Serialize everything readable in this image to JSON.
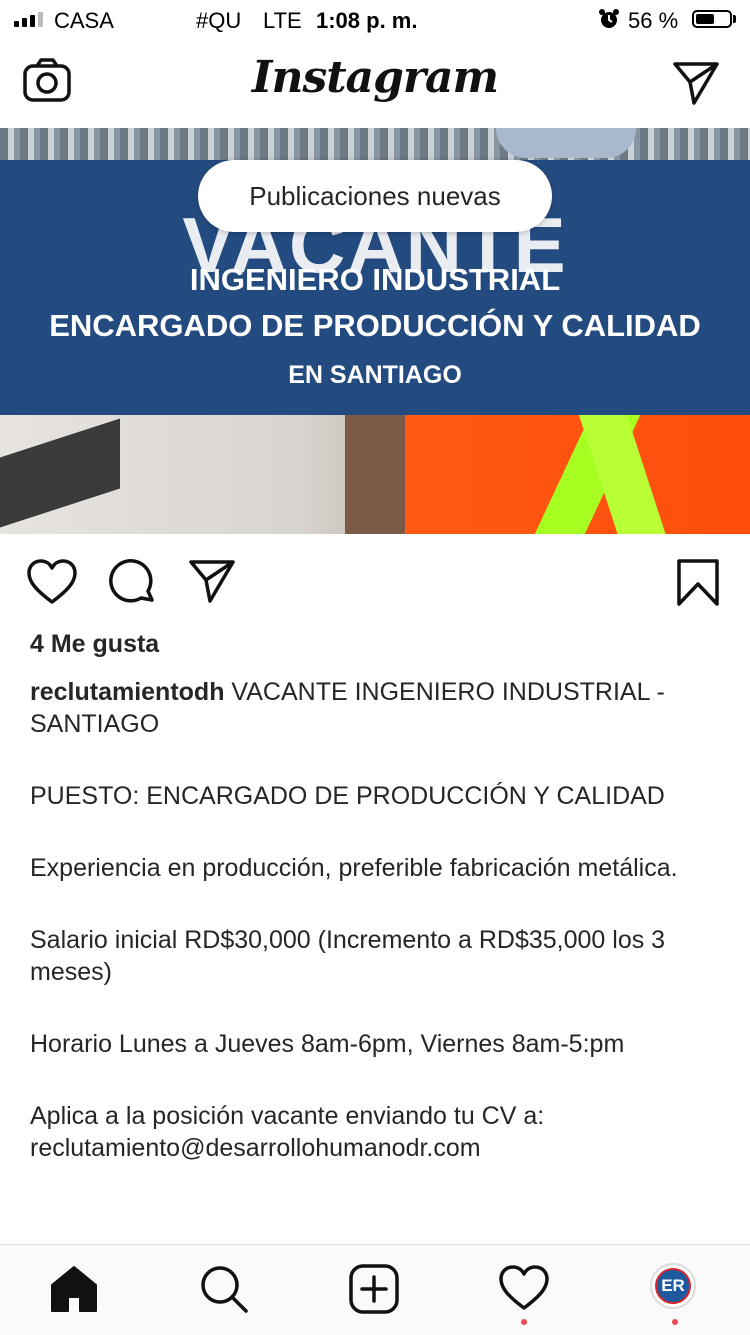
{
  "status_bar": {
    "carrier": "CASA",
    "network_name": "#QU",
    "network_type": "LTE",
    "time": "1:08 p. m.",
    "battery_percent": "56 %",
    "battery_level": 0.56
  },
  "header": {
    "logo_text": "Instagram",
    "camera_icon": "camera-icon",
    "direct_icon": "paper-plane-icon"
  },
  "post": {
    "new_posts_pill": "Publicaciones nuevas",
    "image": {
      "ghost_text": "VACANTE",
      "line1": "INGENIERO INDUSTRIAL",
      "line2": "ENCARGADO DE PRODUCCIÓN Y CALIDAD",
      "line3": "EN SANTIAGO",
      "band_color": "#244b80"
    },
    "actions": {
      "like_icon": "heart-icon",
      "comment_icon": "comment-icon",
      "share_icon": "paper-plane-icon",
      "save_icon": "bookmark-icon"
    },
    "likes": "4 Me gusta",
    "username": "reclutamientodh",
    "caption_first": " VACANTE INGENIERO INDUSTRIAL - SANTIAGO",
    "caption_paragraphs": [
      "PUESTO: ENCARGADO DE PRODUCCIÓN Y CALIDAD",
      "Experiencia en producción, preferible fabricación metálica.",
      "Salario inicial RD$30,000 (Incremento a RD$35,000 los 3 meses)",
      "Horario Lunes a Jueves 8am-6pm, Viernes 8am-5:pm",
      "Aplica a la posición vacante enviando tu CV a: reclutamiento@desarrollohumanodr.com"
    ]
  },
  "bottom_nav": {
    "home_icon": "home-icon",
    "search_icon": "search-icon",
    "add_icon": "add-post-icon",
    "activity_icon": "heart-icon",
    "profile_avatar_text": "ER",
    "notification_color": "#ed4956"
  }
}
